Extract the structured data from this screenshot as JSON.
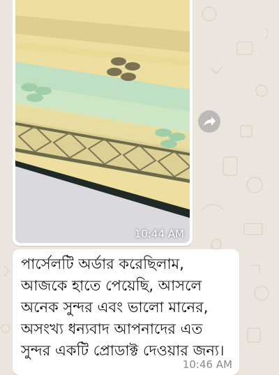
{
  "chat": {
    "image_message": {
      "time": "10:44 AM"
    },
    "forward_icon": "forward-arrow-icon",
    "text_message": {
      "lines": [
        "পার্সেলটি অর্ডার করেছিলাম,",
        "আজকে হাতে পেয়েছি, আসলে",
        "অনেক সুন্দর এবং ভালো মানের,",
        "অসংখ্য ধন্যবাদ আপনাদের এত",
        "সুন্দর একটি প্রোডাক্ট দেওয়ার জন্য।"
      ],
      "time": "10:46 AM"
    }
  },
  "colors": {
    "wallpaper": "#ece5dd",
    "bubble": "#ffffff",
    "saree_base": "#eedfa0",
    "saree_stripe_green": "#bfe0c2",
    "saree_border": "#6b6a4a"
  }
}
